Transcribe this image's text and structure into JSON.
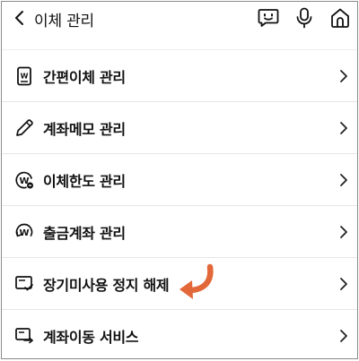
{
  "header": {
    "title": "이체 관리",
    "icons": [
      "back-icon",
      "chatbot-icon",
      "microphone-icon",
      "home-icon"
    ]
  },
  "menu": {
    "items": [
      {
        "label": "간편이체 관리",
        "icon": "easy-transfer-icon"
      },
      {
        "label": "계좌메모 관리",
        "icon": "pencil-icon"
      },
      {
        "label": "이체한도 관리",
        "icon": "limit-won-icon"
      },
      {
        "label": "출금계좌 관리",
        "icon": "withdraw-account-icon"
      },
      {
        "label": "장기미사용 정지 해제",
        "icon": "dormant-account-icon"
      },
      {
        "label": "계좌이동 서비스",
        "icon": "account-transfer-icon"
      }
    ]
  },
  "colors": {
    "annotation_arrow": "#e2683a",
    "text": "#111111",
    "divider": "#e6e6e6"
  }
}
